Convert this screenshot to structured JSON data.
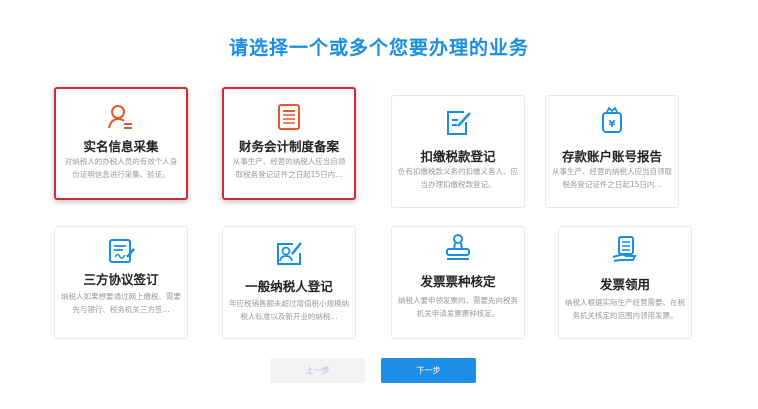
{
  "title": "请选择一个或多个您要办理的业务",
  "accent_color": "#1a8ee5",
  "selected_border_color": "#cf2d35",
  "cards": [
    {
      "name": "实名信息采集",
      "desc": "对纳税人的办税人员的有效个人身份证明信息进行采集、验证。",
      "icon": "person-icon",
      "icon_color": "#e0592f",
      "selected": true
    },
    {
      "name": "财务会计制度备案",
      "desc": "从事生产、经营的纳税人应当自领取税务登记证件之日起15日内...",
      "icon": "document-list-icon",
      "icon_color": "#e0592f",
      "selected": true
    },
    {
      "name": "扣缴税款登记",
      "desc": "负有扣缴税款义务的扣缴义务人、应当办理扣缴税款登记。",
      "icon": "edit-form-icon",
      "icon_color": "#1a8ee5",
      "selected": false
    },
    {
      "name": "存款账户账号报告",
      "desc": "从事生产、经营的纳税人应当自领取税务登记证件之日起15日内...",
      "icon": "yuan-bag-icon",
      "icon_color": "#1a8ee5",
      "selected": false
    },
    {
      "name": "三方协议签订",
      "desc": "纳税人如果想要通过网上缴税、需要先与银行、税务机关三方签...",
      "icon": "signed-document-icon",
      "icon_color": "#1a8ee5",
      "selected": false
    },
    {
      "name": "一般纳税人登记",
      "desc": "年应税销售额未超过增值税小规模纳税人标准以及新开业的纳税...",
      "icon": "id-card-icon",
      "icon_color": "#1a8ee5",
      "selected": false
    },
    {
      "name": "发票票种核定",
      "desc": "纳税人要申领发票的、需要先向税务机关申请发票票种核定。",
      "icon": "stamp-icon",
      "icon_color": "#1a8ee5",
      "selected": false
    },
    {
      "name": "发票领用",
      "desc": "纳税人根据实际生产经营需要、在税务机关核定的范围内领用发票。",
      "icon": "hand-receipt-icon",
      "icon_color": "#1a8ee5",
      "selected": false
    }
  ],
  "buttons": {
    "prev": "上一步",
    "next": "下一步"
  }
}
